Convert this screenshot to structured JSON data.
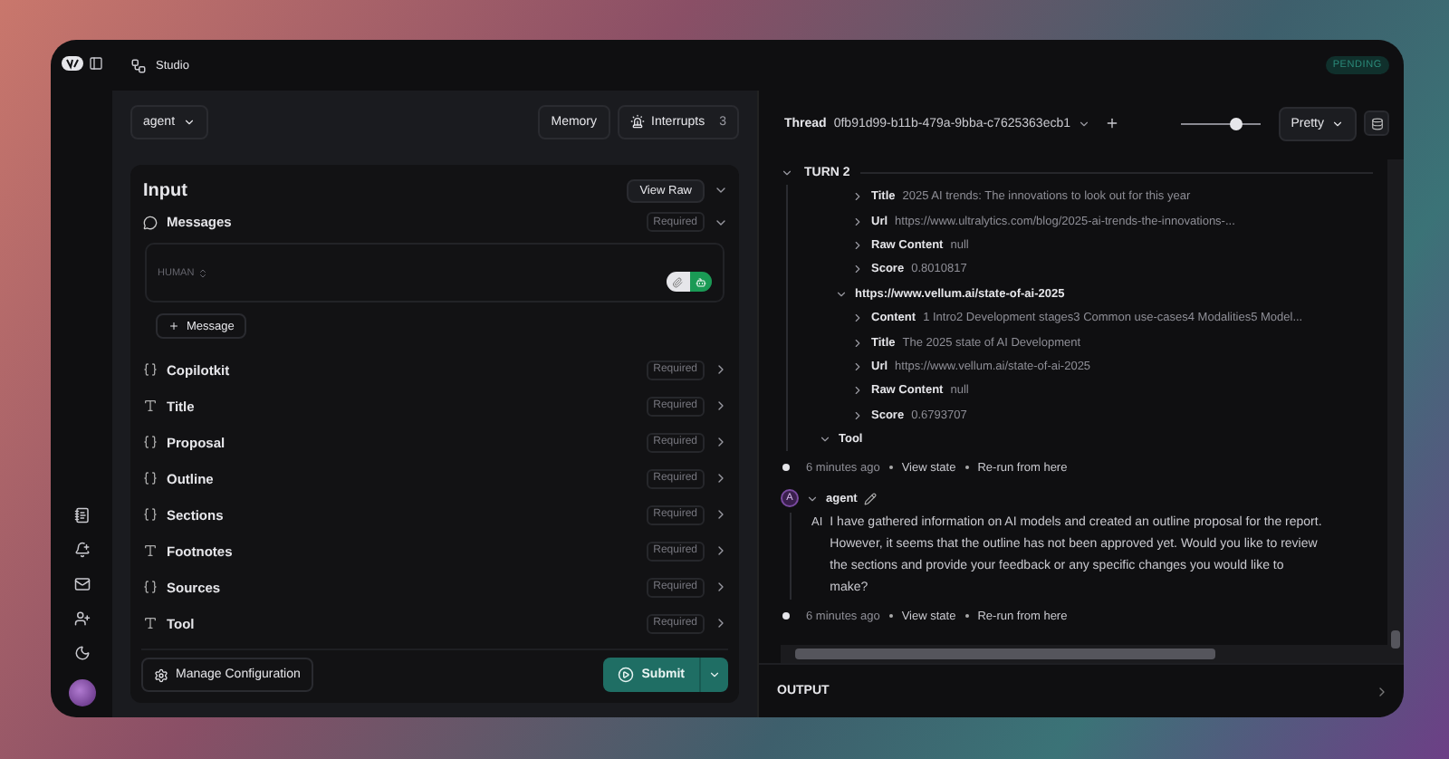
{
  "header": {
    "title": "Studio",
    "status": "PENDING"
  },
  "toolbar": {
    "graph": "agent",
    "memory": "Memory",
    "interrupts": {
      "label": "Interrupts",
      "count": "3"
    }
  },
  "input": {
    "title": "Input",
    "view_raw": "View Raw",
    "expanded": true,
    "messages": {
      "label": "Messages",
      "badge": "Required",
      "expanded": true,
      "role": "HUMAN",
      "toggle_on": true,
      "add_label": "Message"
    },
    "fields": [
      {
        "kind": "object",
        "label": "Copilotkit",
        "badge": "Required"
      },
      {
        "kind": "text",
        "label": "Title",
        "badge": "Required"
      },
      {
        "kind": "object",
        "label": "Proposal",
        "badge": "Required"
      },
      {
        "kind": "object",
        "label": "Outline",
        "badge": "Required"
      },
      {
        "kind": "object",
        "label": "Sections",
        "badge": "Required"
      },
      {
        "kind": "text",
        "label": "Footnotes",
        "badge": "Required"
      },
      {
        "kind": "object",
        "label": "Sources",
        "badge": "Required"
      },
      {
        "kind": "text",
        "label": "Tool",
        "badge": "Required"
      }
    ],
    "manage": "Manage Configuration",
    "submit": "Submit"
  },
  "thread": {
    "label": "Thread",
    "id": "0fb91d99-b11b-479a-9bba-c7625363ecb1",
    "slider": {
      "level": 0.7
    },
    "view": "Pretty",
    "turn": {
      "label": "TURN 2",
      "expanded": true
    },
    "tree": [
      {
        "children": [
          {
            "children": [
              {
                "key": "Title",
                "value": "2025 AI trends: The innovations to look out for this year",
                "expanded": false
              },
              {
                "key": "Url",
                "value": "https://www.ultralytics.com/blog/2025-ai-trends-the-innovations-...",
                "expanded": false
              },
              {
                "key": "Raw Content",
                "value": "null",
                "expanded": false
              },
              {
                "key": "Score",
                "value": "0.8010817",
                "expanded": false
              }
            ]
          },
          {
            "key": "https://www.vellum.ai/state-of-ai-2025",
            "expanded": true,
            "children": [
              {
                "key": "Content",
                "value": "1 Intro2 Development stages3 Common use-cases4 Modalities5 Model...",
                "expanded": false
              },
              {
                "key": "Title",
                "value": "The 2025 state of AI Development",
                "expanded": false
              },
              {
                "key": "Url",
                "value": "https://www.vellum.ai/state-of-ai-2025",
                "expanded": false
              },
              {
                "key": "Raw Content",
                "value": "null",
                "expanded": false
              },
              {
                "key": "Score",
                "value": "0.6793707",
                "expanded": false
              }
            ]
          }
        ]
      },
      {
        "key": "Tool",
        "expanded": true
      }
    ],
    "timeline": [
      {
        "kind": "event",
        "time": "6 minutes ago",
        "view": "View state",
        "rerun": "Re-run from here"
      },
      {
        "kind": "message",
        "avatar": "A",
        "name": "agent",
        "expanded": true,
        "prefix": "AI",
        "text": "I have gathered information on AI models and created an outline proposal for the report. However, it seems that the outline has not been approved yet. Would you like to review the sections and provide your feedback or any specific changes you would like to make?"
      },
      {
        "kind": "event",
        "time": "6 minutes ago",
        "view": "View state",
        "rerun": "Re-run from here"
      }
    ]
  },
  "output": {
    "label": "OUTPUT"
  }
}
